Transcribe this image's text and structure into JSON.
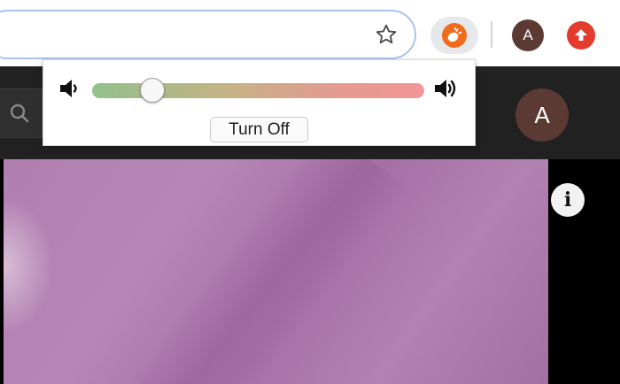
{
  "toolbar": {
    "bookmark_icon": "star-outline-icon",
    "extension_icon": "orange-hand-icon",
    "extension_color": "#f26b1d",
    "profile_initial": "A",
    "profile_color": "#5a3a33",
    "upload_icon": "upload-arrow-icon",
    "upload_color": "#e43b2c"
  },
  "popup": {
    "volume_low_icon": "speaker-low-icon",
    "volume_high_icon": "speaker-high-icon",
    "volume_fraction": 0.18,
    "button_label": "Turn Off"
  },
  "site_header": {
    "background": "#212121",
    "search_icon": "search-icon",
    "avatar_initial": "A",
    "avatar_color": "#5a3a33"
  },
  "video": {
    "info_icon": "info-icon",
    "info_label": "i"
  }
}
